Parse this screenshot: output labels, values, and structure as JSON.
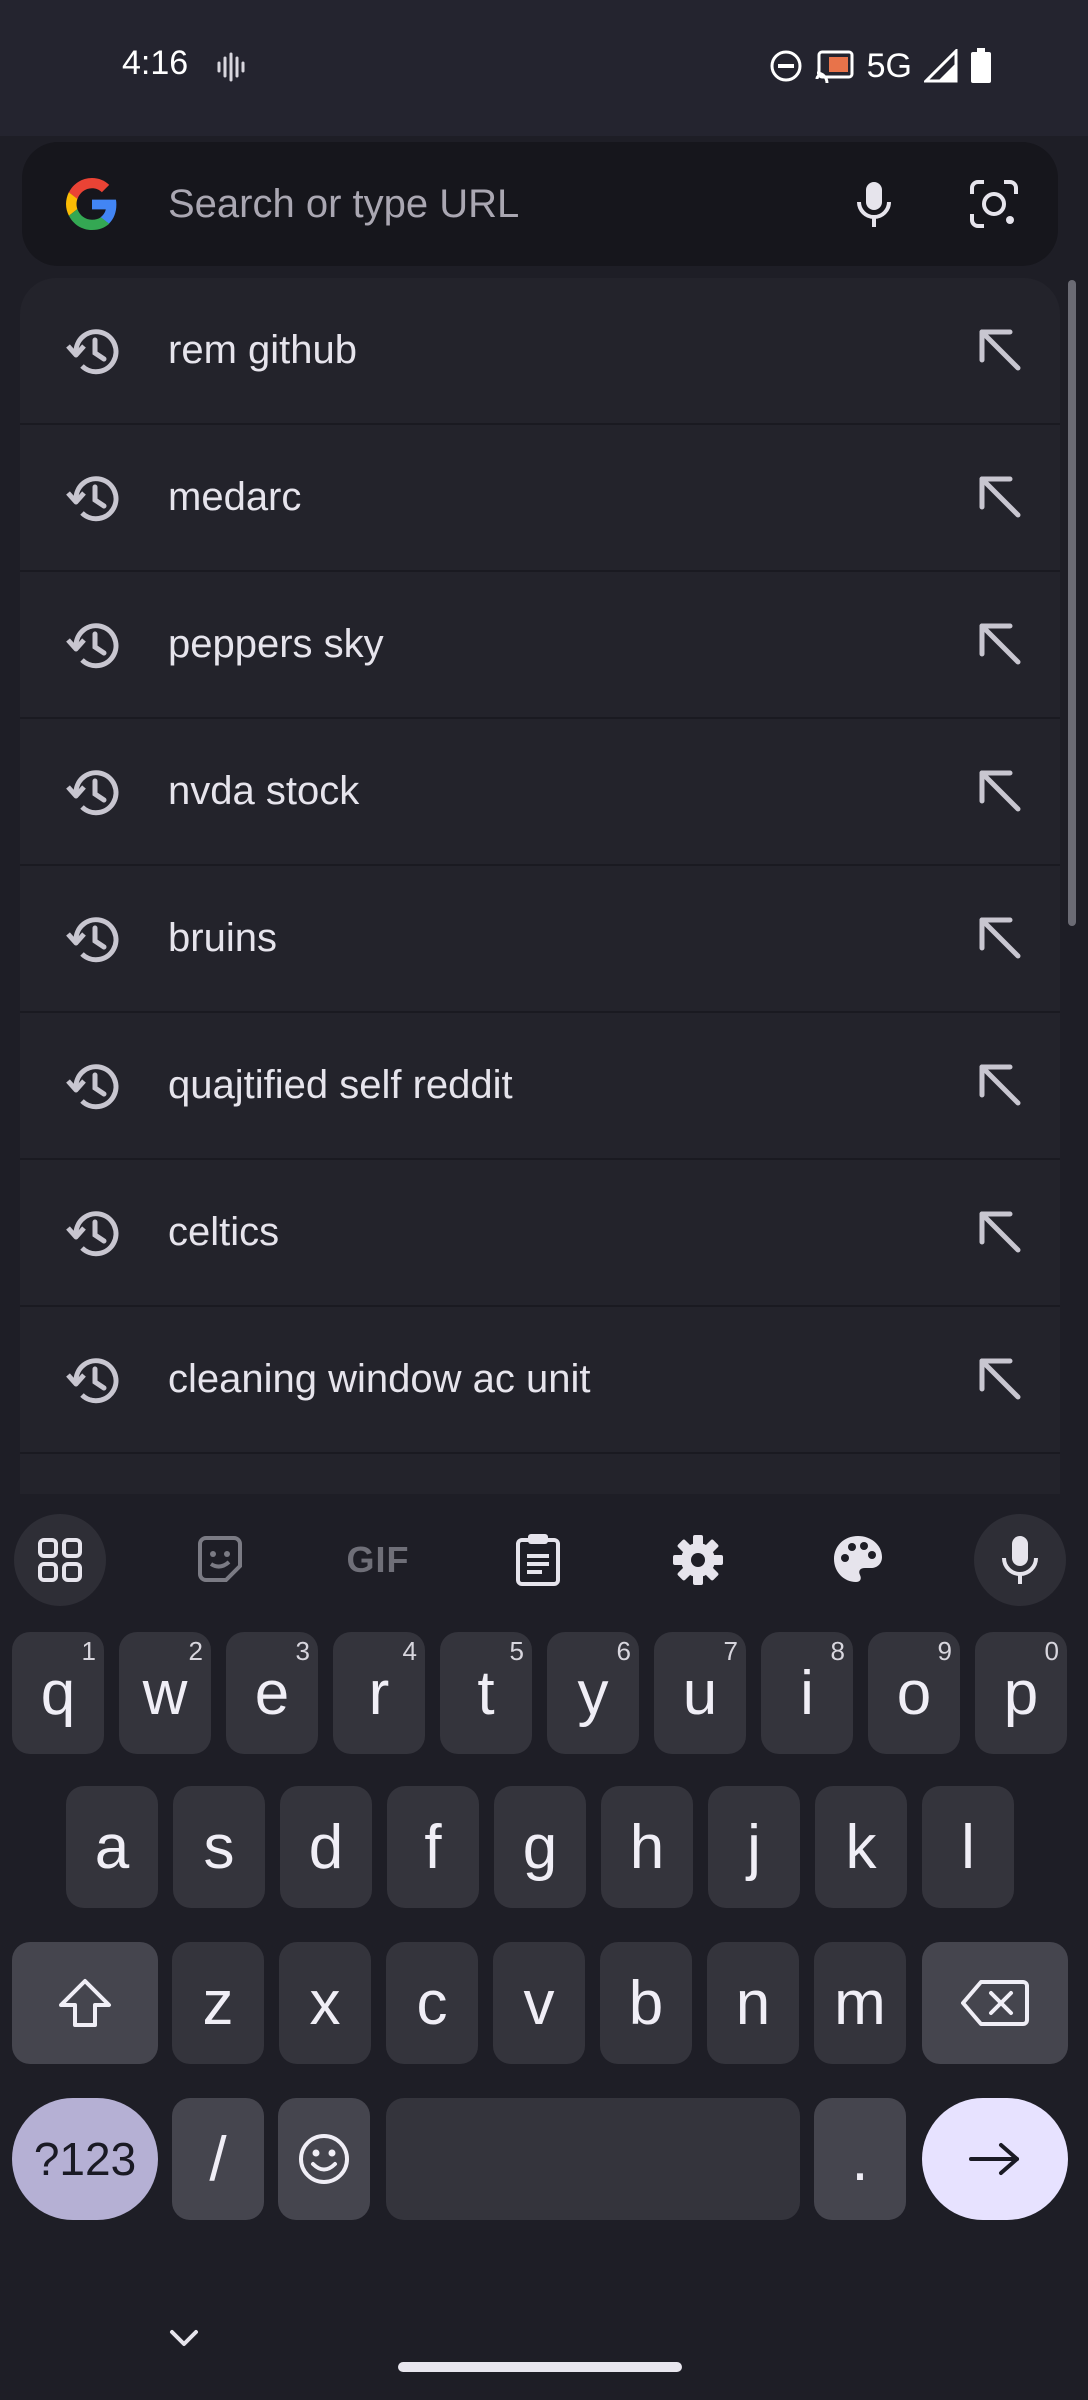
{
  "status_bar": {
    "time": "4:16",
    "network": "5G",
    "icons": [
      "vibrate-icon",
      "do-not-disturb-icon",
      "cast-icon",
      "signal-icon",
      "battery-icon"
    ]
  },
  "search": {
    "placeholder": "Search or type URL",
    "value": "",
    "icons": [
      "google-logo",
      "mic-icon",
      "lens-icon"
    ]
  },
  "suggestions": [
    {
      "label": "rem github"
    },
    {
      "label": "medarc"
    },
    {
      "label": "peppers sky"
    },
    {
      "label": "nvda stock"
    },
    {
      "label": "bruins"
    },
    {
      "label": "quajtified self reddit"
    },
    {
      "label": "celtics"
    },
    {
      "label": "cleaning window ac unit"
    }
  ],
  "keyboard": {
    "toolbar": {
      "gif_label": "GIF",
      "icons": [
        "apps-grid-icon",
        "sticker-icon",
        "clipboard-icon",
        "settings-icon",
        "palette-icon",
        "voice-mic-icon"
      ]
    },
    "row1": [
      {
        "key": "q",
        "hint": "1"
      },
      {
        "key": "w",
        "hint": "2"
      },
      {
        "key": "e",
        "hint": "3"
      },
      {
        "key": "r",
        "hint": "4"
      },
      {
        "key": "t",
        "hint": "5"
      },
      {
        "key": "y",
        "hint": "6"
      },
      {
        "key": "u",
        "hint": "7"
      },
      {
        "key": "i",
        "hint": "8"
      },
      {
        "key": "o",
        "hint": "9"
      },
      {
        "key": "p",
        "hint": "0"
      }
    ],
    "row2": [
      "a",
      "s",
      "d",
      "f",
      "g",
      "h",
      "j",
      "k",
      "l"
    ],
    "row3": [
      "z",
      "x",
      "c",
      "v",
      "b",
      "n",
      "m"
    ],
    "symbols_label": "?123",
    "slash_label": "/",
    "period_label": "."
  },
  "colors": {
    "background": "#1e1e26",
    "suggestion_panel": "#23232b",
    "key": "#34343c",
    "symbols_key": "#b5b0d4",
    "enter_key": "#e7e2ff"
  }
}
